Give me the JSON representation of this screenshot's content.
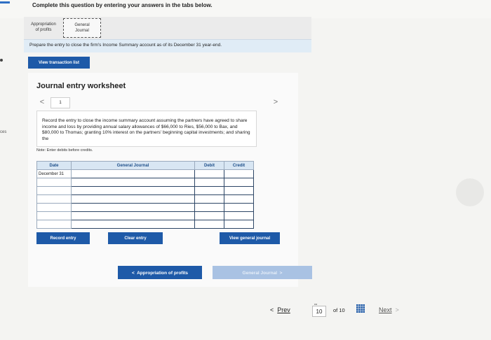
{
  "header": {
    "instruction": "Complete this question by entering your answers in the tabs below."
  },
  "tabs": [
    {
      "line1": "Appropriation",
      "line2": "of profits"
    },
    {
      "line1": "General",
      "line2": "Journal"
    }
  ],
  "prepare_text": "Prepare the entry to close the firm's Income Summary account as of its December 31 year-end.",
  "view_transaction_label": "View transaction list",
  "left_stub": "ces",
  "worksheet": {
    "title": "Journal entry worksheet",
    "prev_glyph": "<",
    "next_glyph": ">",
    "page": "1",
    "description": "Record the entry to close the income summary account assuming the partners have agreed to share income and loss by providing annual salary allowances of $66,000 to Ries, $56,000 to Bax, and $80,000 to Thomas; granting 10% interest on the partners' beginning capital investments; and sharing the",
    "note": "Note: Enter debits before credits.",
    "columns": [
      "Date",
      "General Journal",
      "Debit",
      "Credit"
    ],
    "first_date": "December 31",
    "record_label": "Record entry",
    "clear_label": "Clear entry",
    "view_gj_label": "View general journal"
  },
  "nav": {
    "approp_label": "Appropriation of profits",
    "approp_glyph": "<",
    "gj_label": "General Journal",
    "gj_glyph": ">",
    "prev_label": "Prev",
    "prev_glyph": "<",
    "page_tiny": "co",
    "page": "10",
    "of_total": "of 10",
    "next_label": "Next",
    "next_glyph": ">"
  },
  "colors": {
    "primary": "#1e5aa8",
    "header_fill": "#d8e6f3",
    "banner": "#e0ecf6"
  },
  "icons": [
    "grid-icon",
    "chevron-left-icon",
    "chevron-right-icon"
  ]
}
